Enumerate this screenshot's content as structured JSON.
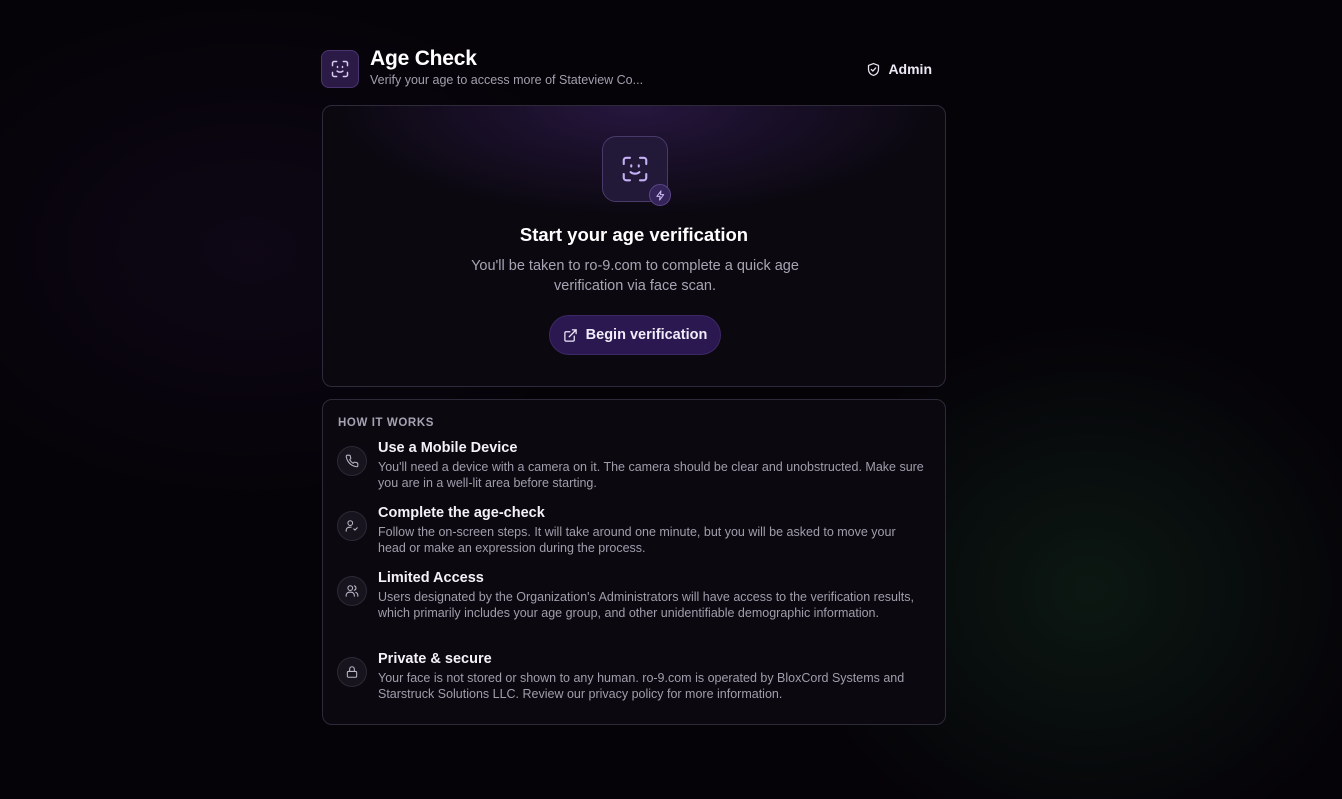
{
  "header": {
    "title": "Age Check",
    "subtitle": "Verify your age to access more of Stateview Co...",
    "logo_icon": "face-scan-icon",
    "admin_label": "Admin",
    "admin_icon": "shield-check-icon"
  },
  "verify": {
    "icon": "face-scan-icon",
    "badge_icon": "bolt-icon",
    "title": "Start your age verification",
    "description": "You'll be taken to ro-9.com to complete a quick age verification via face scan.",
    "button_label": "Begin verification",
    "button_icon": "external-link-icon"
  },
  "how": {
    "heading": "HOW IT WORKS",
    "steps": [
      {
        "icon": "phone-icon",
        "title": "Use a Mobile Device",
        "text": "You'll need a device with a camera on it. The camera should be clear and unobstructed. Make sure you are in a well-lit area before starting."
      },
      {
        "icon": "user-check-icon",
        "title": "Complete the age-check",
        "text": "Follow the on-screen steps. It will take around one minute, but you will be asked to move your head or make an expression during the process."
      },
      {
        "icon": "users-icon",
        "title": "Limited Access",
        "text": "Users designated by the Organization's Administrators will have access to the verification results, which primarily includes your age group, and other unidentifiable demographic information."
      },
      {
        "icon": "lock-icon",
        "title": "Private & secure",
        "text": "Your face is not stored or shown to any human. ro-9.com is operated by BloxCord Systems and Starstruck Solutions LLC. Review our privacy policy for more information."
      }
    ]
  },
  "colors": {
    "background": "#050308",
    "card": "#0b0810",
    "accent": "#2b1850",
    "accent_icon": "#c4b0f4"
  }
}
